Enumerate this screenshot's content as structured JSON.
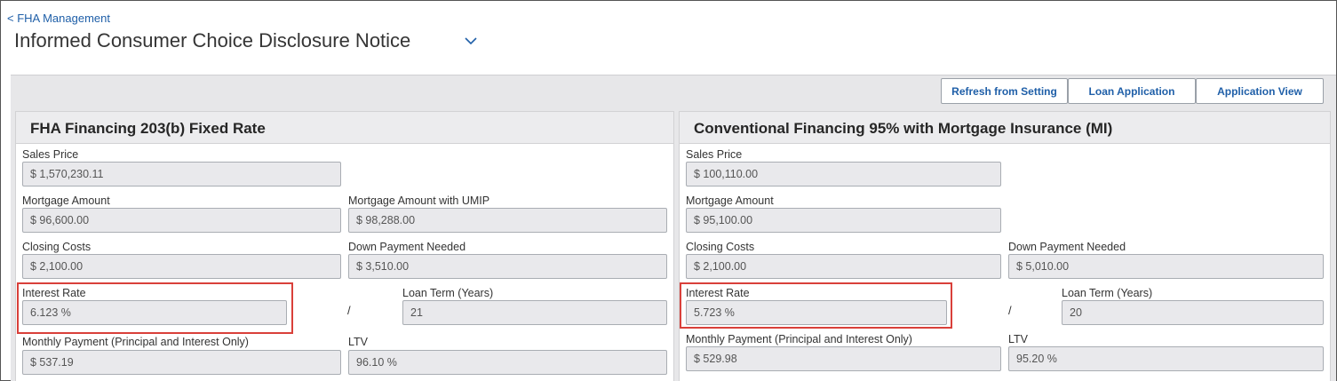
{
  "nav": {
    "back_link": "< FHA Management"
  },
  "header": {
    "title": "Informed Consumer Choice Disclosure Notice"
  },
  "toolbar": {
    "refresh_label": "Refresh from Setting",
    "loan_application_label": "Loan Application",
    "application_view_label": "Application View"
  },
  "fha": {
    "title": "FHA Financing 203(b) Fixed Rate",
    "sales_price_label": "Sales Price",
    "sales_price": "$ 1,570,230.11",
    "mortgage_amount_label": "Mortgage Amount",
    "mortgage_amount": "$ 96,600.00",
    "mortgage_umip_label": "Mortgage Amount with UMIP",
    "mortgage_umip": "$ 98,288.00",
    "closing_costs_label": "Closing Costs",
    "closing_costs": "$ 2,100.00",
    "down_payment_label": "Down Payment Needed",
    "down_payment": "$ 3,510.00",
    "interest_rate_label": "Interest Rate",
    "interest_rate": "6.123 %",
    "separator": "/",
    "loan_term_label": "Loan Term (Years)",
    "loan_term": "21",
    "monthly_payment_label": "Monthly Payment (Principal and Interest Only)",
    "monthly_payment": "$ 537.19",
    "ltv_label": "LTV",
    "ltv": "96.10 %"
  },
  "conventional": {
    "title": "Conventional Financing 95% with Mortgage Insurance (MI)",
    "sales_price_label": "Sales Price",
    "sales_price": "$ 100,110.00",
    "mortgage_amount_label": "Mortgage Amount",
    "mortgage_amount": "$ 95,100.00",
    "closing_costs_label": "Closing Costs",
    "closing_costs": "$ 2,100.00",
    "down_payment_label": "Down Payment Needed",
    "down_payment": "$ 5,010.00",
    "interest_rate_label": "Interest Rate",
    "interest_rate": "5.723 %",
    "separator": "/",
    "loan_term_label": "Loan Term (Years)",
    "loan_term": "20",
    "monthly_payment_label": "Monthly Payment (Principal and Interest Only)",
    "monthly_payment": "$ 529.98",
    "ltv_label": "LTV",
    "ltv": "95.20 %"
  },
  "colors": {
    "link": "#1f5fa8",
    "highlight": "#d9403a",
    "panel_header": "#ececee",
    "input_bg": "#e9e9ec"
  }
}
